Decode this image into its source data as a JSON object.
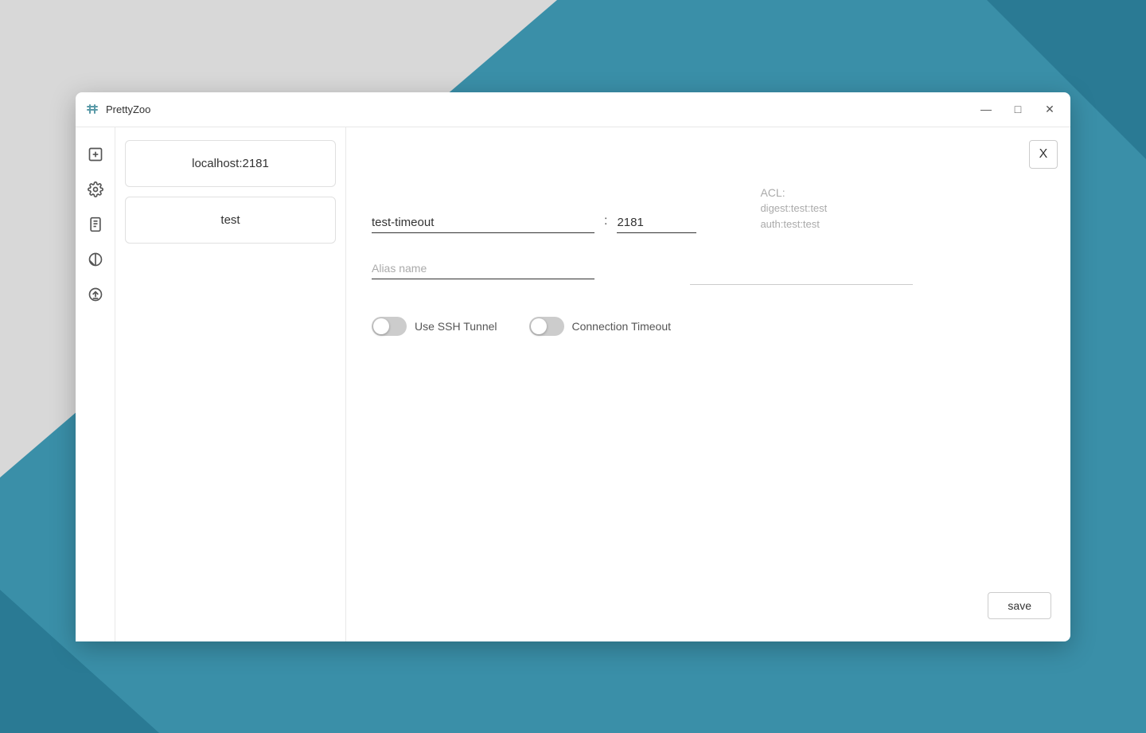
{
  "desktop": {
    "bg_color": "#3a8fa8"
  },
  "window": {
    "title": "PrettyZoo",
    "minimize_label": "—",
    "maximize_label": "□",
    "close_label": "✕"
  },
  "sidebar": {
    "icons": [
      {
        "name": "add-icon",
        "symbol": "+",
        "tooltip": "Add"
      },
      {
        "name": "settings-icon",
        "symbol": "⚙",
        "tooltip": "Settings"
      },
      {
        "name": "logs-icon",
        "symbol": "📋",
        "tooltip": "Logs"
      },
      {
        "name": "theme-icon",
        "symbol": "◑",
        "tooltip": "Theme"
      },
      {
        "name": "update-icon",
        "symbol": "⬆",
        "tooltip": "Update"
      }
    ]
  },
  "connections": [
    {
      "id": "localhost",
      "label": "localhost:2181"
    },
    {
      "id": "test",
      "label": "test"
    }
  ],
  "form": {
    "close_btn": "X",
    "host_value": "test-timeout",
    "port_separator": ":",
    "port_value": "2181",
    "alias_placeholder": "Alias name",
    "acl_label": "ACL:",
    "acl_line1": "digest:test:test",
    "acl_line2": "auth:test:test",
    "acl_input_value": "",
    "ssh_tunnel_label": "Use SSH Tunnel",
    "connection_timeout_label": "Connection Timeout",
    "save_label": "save"
  }
}
